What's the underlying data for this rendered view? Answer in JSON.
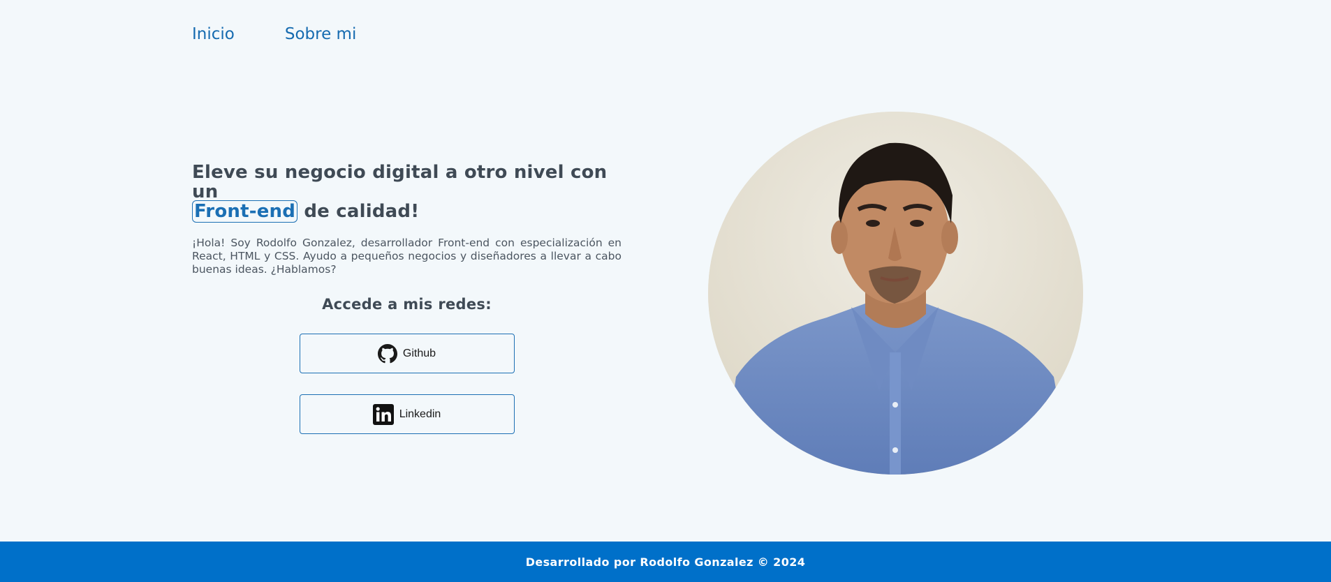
{
  "nav": {
    "items": [
      {
        "label": "Inicio"
      },
      {
        "label": "Sobre mi"
      }
    ]
  },
  "hero": {
    "headline_before": "Eleve su negocio digital a otro nivel con un",
    "headline_highlight": "Front-end",
    "headline_after": "de calidad!",
    "intro": "¡Hola! Soy Rodolfo Gonzalez, desarrollador Front-end con especialización en React, HTML y CSS. Ayudo a pequeños negocios y diseñadores a llevar a cabo buenas ideas. ¿Hablamos?",
    "social_title": "Accede a mis redes:",
    "social": [
      {
        "label": "Github",
        "icon": "github-icon"
      },
      {
        "label": "Linkedin",
        "icon": "linkedin-icon"
      }
    ]
  },
  "portrait": {
    "icon": "profile-photo"
  },
  "footer": {
    "text": "Desarrollado por Rodolfo Gonzalez © 2024"
  },
  "colors": {
    "background": "#f3f8fb",
    "accent": "#1b6fb4",
    "footer": "#0070c9",
    "text": "#3f4a55"
  }
}
